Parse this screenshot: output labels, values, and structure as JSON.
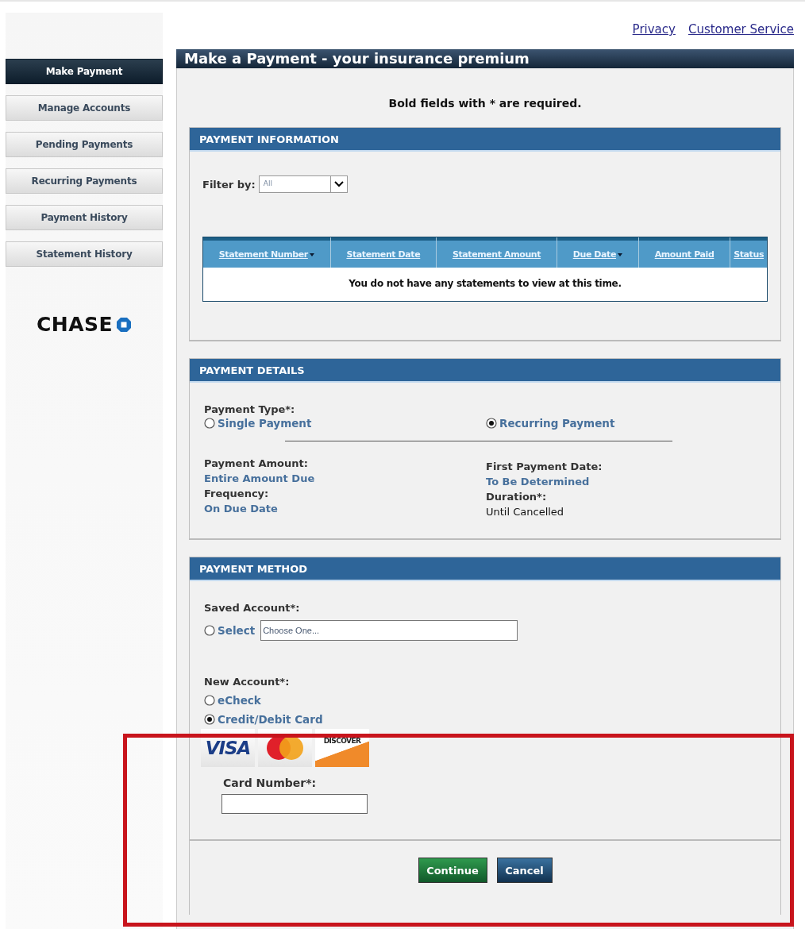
{
  "top_links": [
    {
      "label": "Privacy"
    },
    {
      "label": "Customer Service"
    }
  ],
  "sidebar": {
    "items": [
      {
        "label": "Make Payment",
        "selected": true
      },
      {
        "label": "Manage Accounts",
        "selected": false
      },
      {
        "label": "Pending Payments",
        "selected": false
      },
      {
        "label": "Recurring Payments",
        "selected": false
      },
      {
        "label": "Payment History",
        "selected": false
      },
      {
        "label": "Statement History",
        "selected": false
      }
    ],
    "logo": "CHASE"
  },
  "page_title": "Make a Payment - your insurance premium",
  "required_note": "Bold fields with * are required.",
  "payment_information": {
    "title": "PAYMENT INFORMATION",
    "filter_label": "Filter by:",
    "filter_value": "All",
    "table": {
      "columns": [
        {
          "label": "Statement Number",
          "sortable": true
        },
        {
          "label": "Statement Date",
          "sortable": false
        },
        {
          "label": "Statement Amount",
          "sortable": false
        },
        {
          "label": "Due Date",
          "sortable": true
        },
        {
          "label": "Amount Paid",
          "sortable": false
        },
        {
          "label": "Status",
          "sortable": false
        }
      ],
      "empty_message": "You do not have any statements to view at this time."
    }
  },
  "payment_details": {
    "title": "PAYMENT DETAILS",
    "type_label": "Payment Type*:",
    "types": [
      {
        "label": "Single Payment",
        "selected": false
      },
      {
        "label": "Recurring Payment",
        "selected": true
      }
    ],
    "left": [
      {
        "label": "Payment Amount:",
        "value": "Entire Amount Due",
        "kind": "link"
      },
      {
        "label": "Frequency:",
        "value": "On Due Date",
        "kind": "link"
      }
    ],
    "right": [
      {
        "label": "First Payment Date:",
        "value": "To Be Determined",
        "kind": "link"
      },
      {
        "label": "Duration*:",
        "value": "Until Cancelled",
        "kind": "plain"
      }
    ]
  },
  "payment_method": {
    "title": "PAYMENT METHOD",
    "saved_label": "Saved Account*:",
    "saved_option": {
      "label": "Select",
      "selected": false
    },
    "saved_placeholder": "Choose One...",
    "new_label": "New Account*:",
    "new_options": [
      {
        "label": "eCheck",
        "selected": false
      },
      {
        "label": "Credit/Debit Card",
        "selected": true
      }
    ],
    "cards": [
      {
        "kind": "visa",
        "label": "VISA"
      },
      {
        "kind": "mastercard"
      },
      {
        "kind": "discover",
        "label": "DISCOVER"
      }
    ],
    "card_number_label": "Card Number*:"
  },
  "buttons": [
    {
      "label": "Continue",
      "kind": "primary"
    },
    {
      "label": "Cancel",
      "kind": "secondary"
    }
  ],
  "annotation": {
    "kind": "highlight"
  }
}
